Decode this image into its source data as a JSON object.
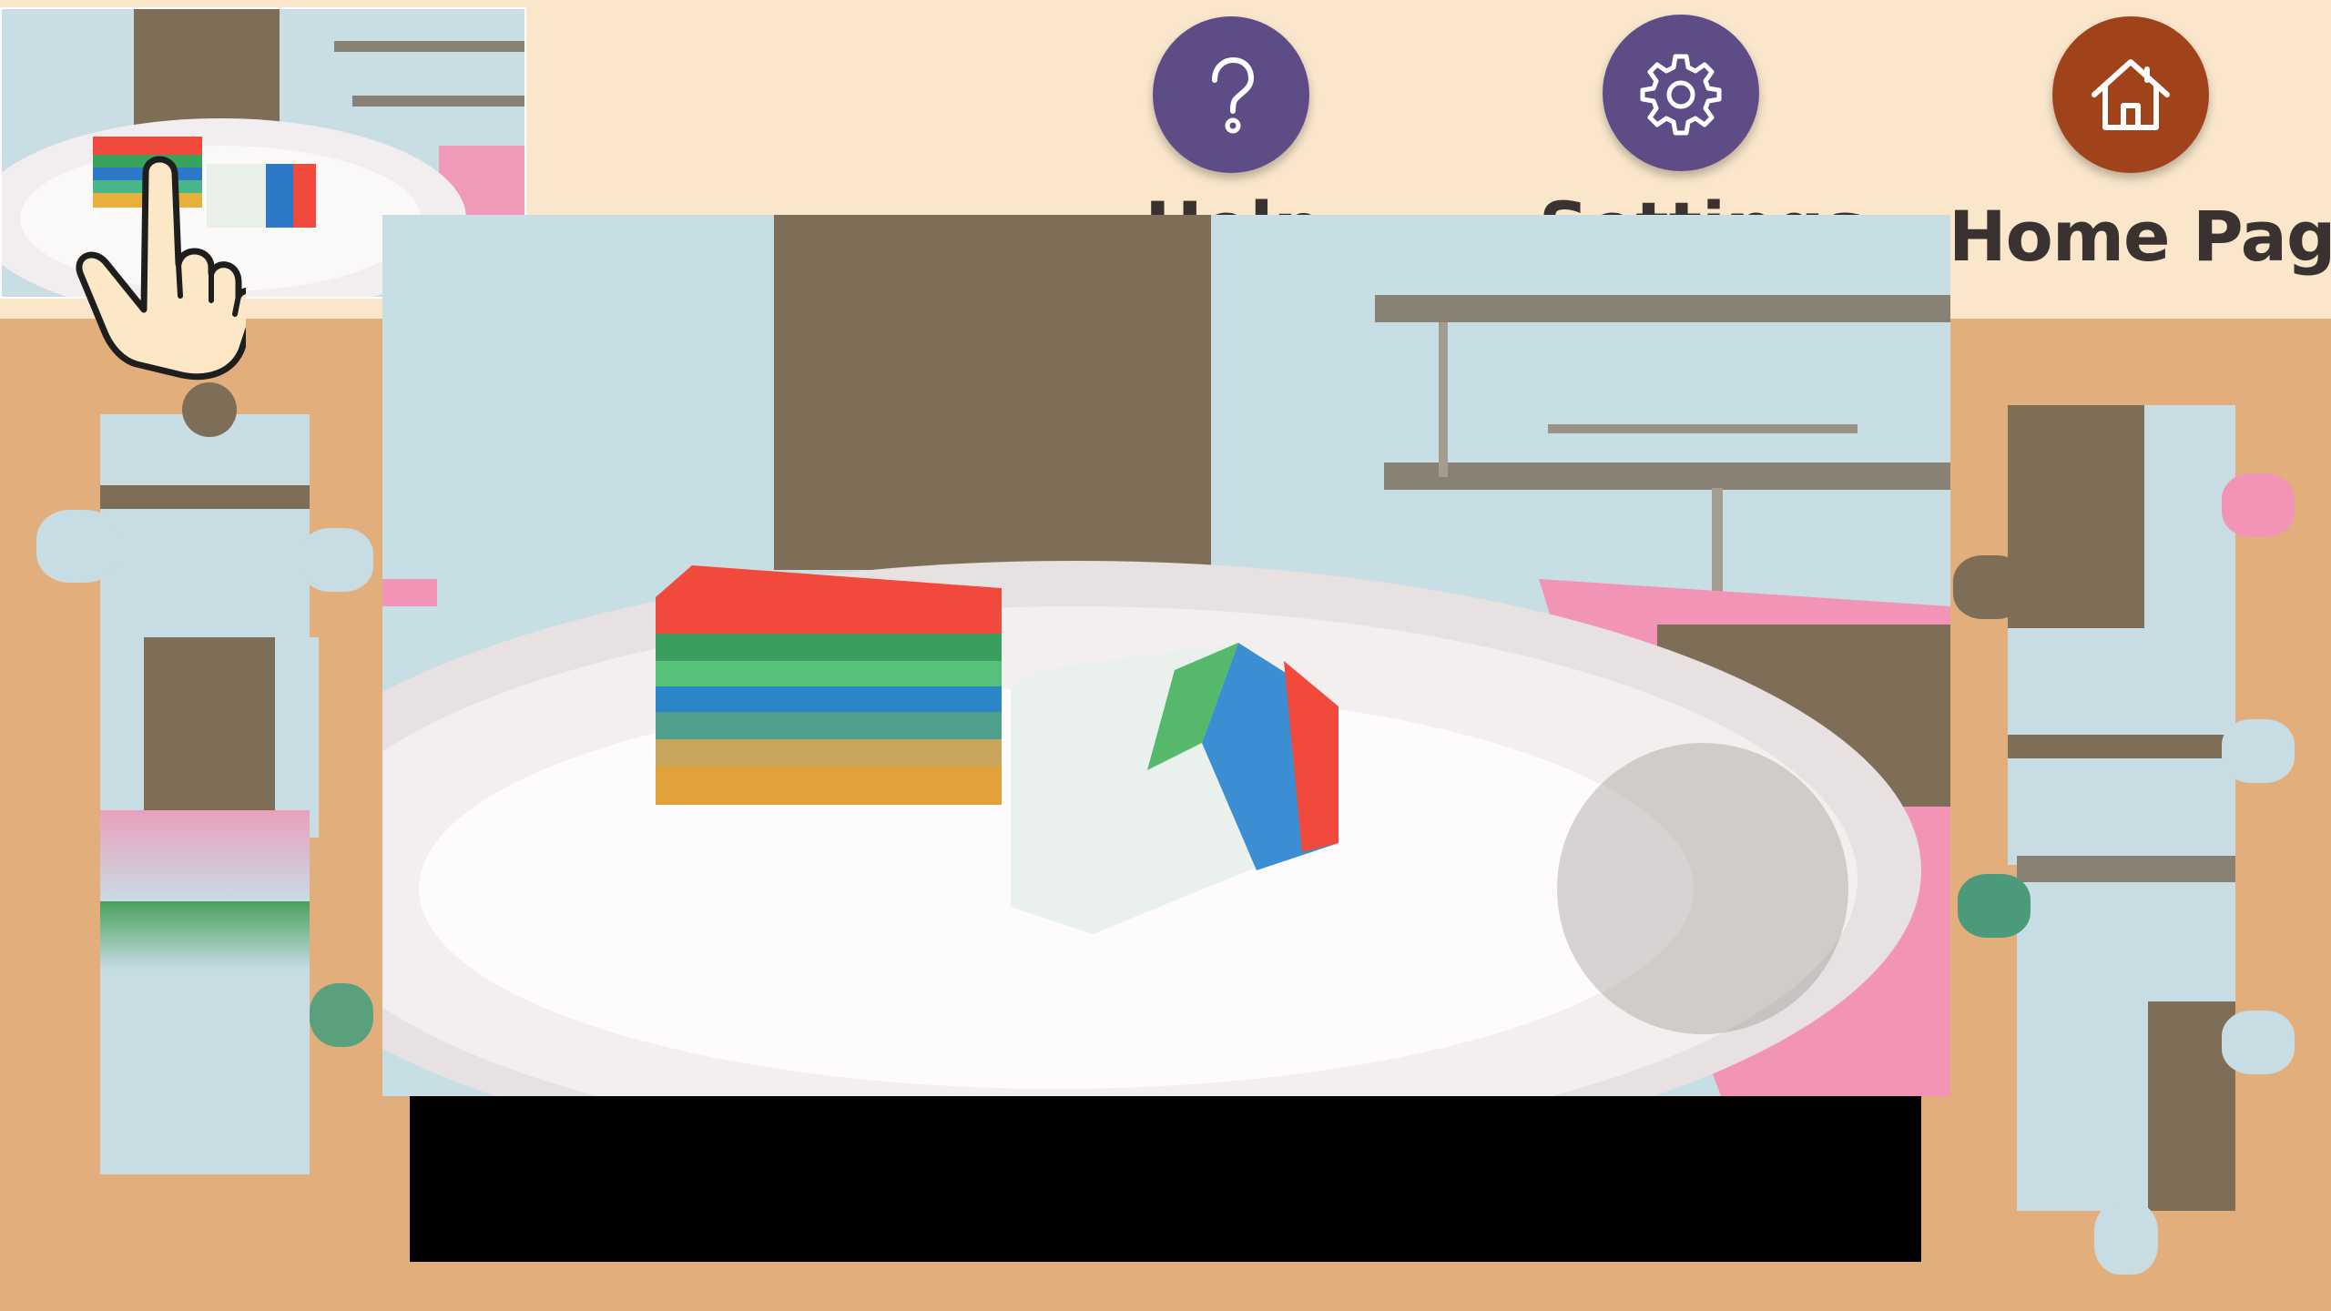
{
  "nav": {
    "help_label": "Help",
    "settings_label": "Settings",
    "home_label": "Home Page"
  },
  "icons": [
    "question-mark-icon",
    "gear-icon",
    "house-icon",
    "pointing-hand-icon"
  ],
  "colors": {
    "background": "#E2AE7C",
    "topbar": "#F9E6CB",
    "help_button": "#5D4C86",
    "settings_button": "#5D4C86",
    "home_button": "#A0431B"
  }
}
